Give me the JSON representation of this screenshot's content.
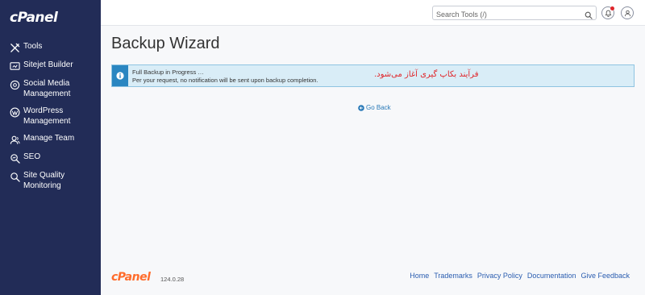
{
  "sidebar": {
    "logo": "cPanel",
    "items": [
      {
        "label": "Tools",
        "icon": "tools-icon"
      },
      {
        "label": "Sitejet Builder",
        "icon": "sitejet-icon"
      },
      {
        "label": "Social Media Management",
        "icon": "social-media-icon"
      },
      {
        "label": "WordPress Management",
        "icon": "wordpress-icon"
      },
      {
        "label": "Manage Team",
        "icon": "team-icon"
      },
      {
        "label": "SEO",
        "icon": "seo-icon"
      },
      {
        "label": "Site Quality Monitoring",
        "icon": "site-quality-icon"
      }
    ]
  },
  "header": {
    "search_placeholder": "Search Tools (/)"
  },
  "main": {
    "title": "Backup Wizard",
    "alert": {
      "line1": "Full Backup in Progress …",
      "line2": "Per your request, no notification will be sent upon backup completion.",
      "annotation": "فرآیند بکاپ گیری آغاز می‌شود."
    },
    "go_back": "Go Back"
  },
  "footer": {
    "logo": "cPanel",
    "version": "124.0.28",
    "links": [
      "Home",
      "Trademarks",
      "Privacy Policy",
      "Documentation",
      "Give Feedback"
    ]
  },
  "colors": {
    "sidebar_bg": "#222c57",
    "alert_bg": "#d9edf7",
    "alert_accent": "#2a86c1",
    "brand_orange": "#ff6c2c",
    "annotation_red": "#e0262b",
    "link_blue": "#2a5db0"
  }
}
